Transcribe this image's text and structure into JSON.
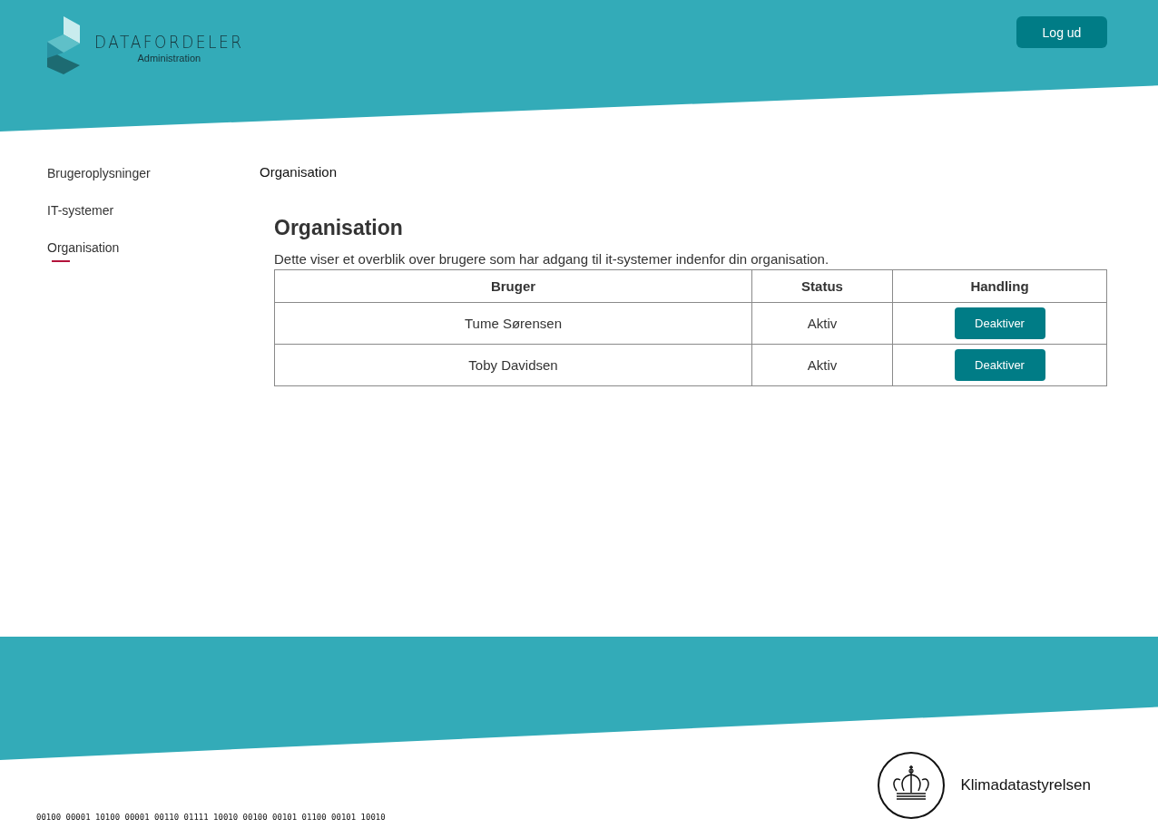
{
  "header": {
    "logo": {
      "title": "DATAFORDELER",
      "subtitle": "Administration"
    },
    "logout_button": "Log ud"
  },
  "sidebar": {
    "items": [
      {
        "label": "Brugeroplysninger",
        "selected": false
      },
      {
        "label": "IT-systemer",
        "selected": false
      },
      {
        "label": "Organisation",
        "selected": true
      }
    ]
  },
  "breadcrumb": "Organisation",
  "heading": "Organisation",
  "description": "Dette viser et overblik over brugere som har adgang til it-systemer indenfor din organisation.",
  "table": {
    "columns": [
      "Bruger",
      "Status",
      "Handling"
    ],
    "rows": [
      {
        "user": "Tume Sørensen",
        "status": "Aktiv",
        "action": "Deaktiver"
      },
      {
        "user": "Toby Davidsen",
        "status": "Aktiv",
        "action": "Deaktiver"
      }
    ]
  },
  "footer": {
    "binary": "00100 00001 10100 00001 00110 01111 10010 00100 00101 01100 00101 10010",
    "agency": "Klimadatastyrelsen"
  }
}
